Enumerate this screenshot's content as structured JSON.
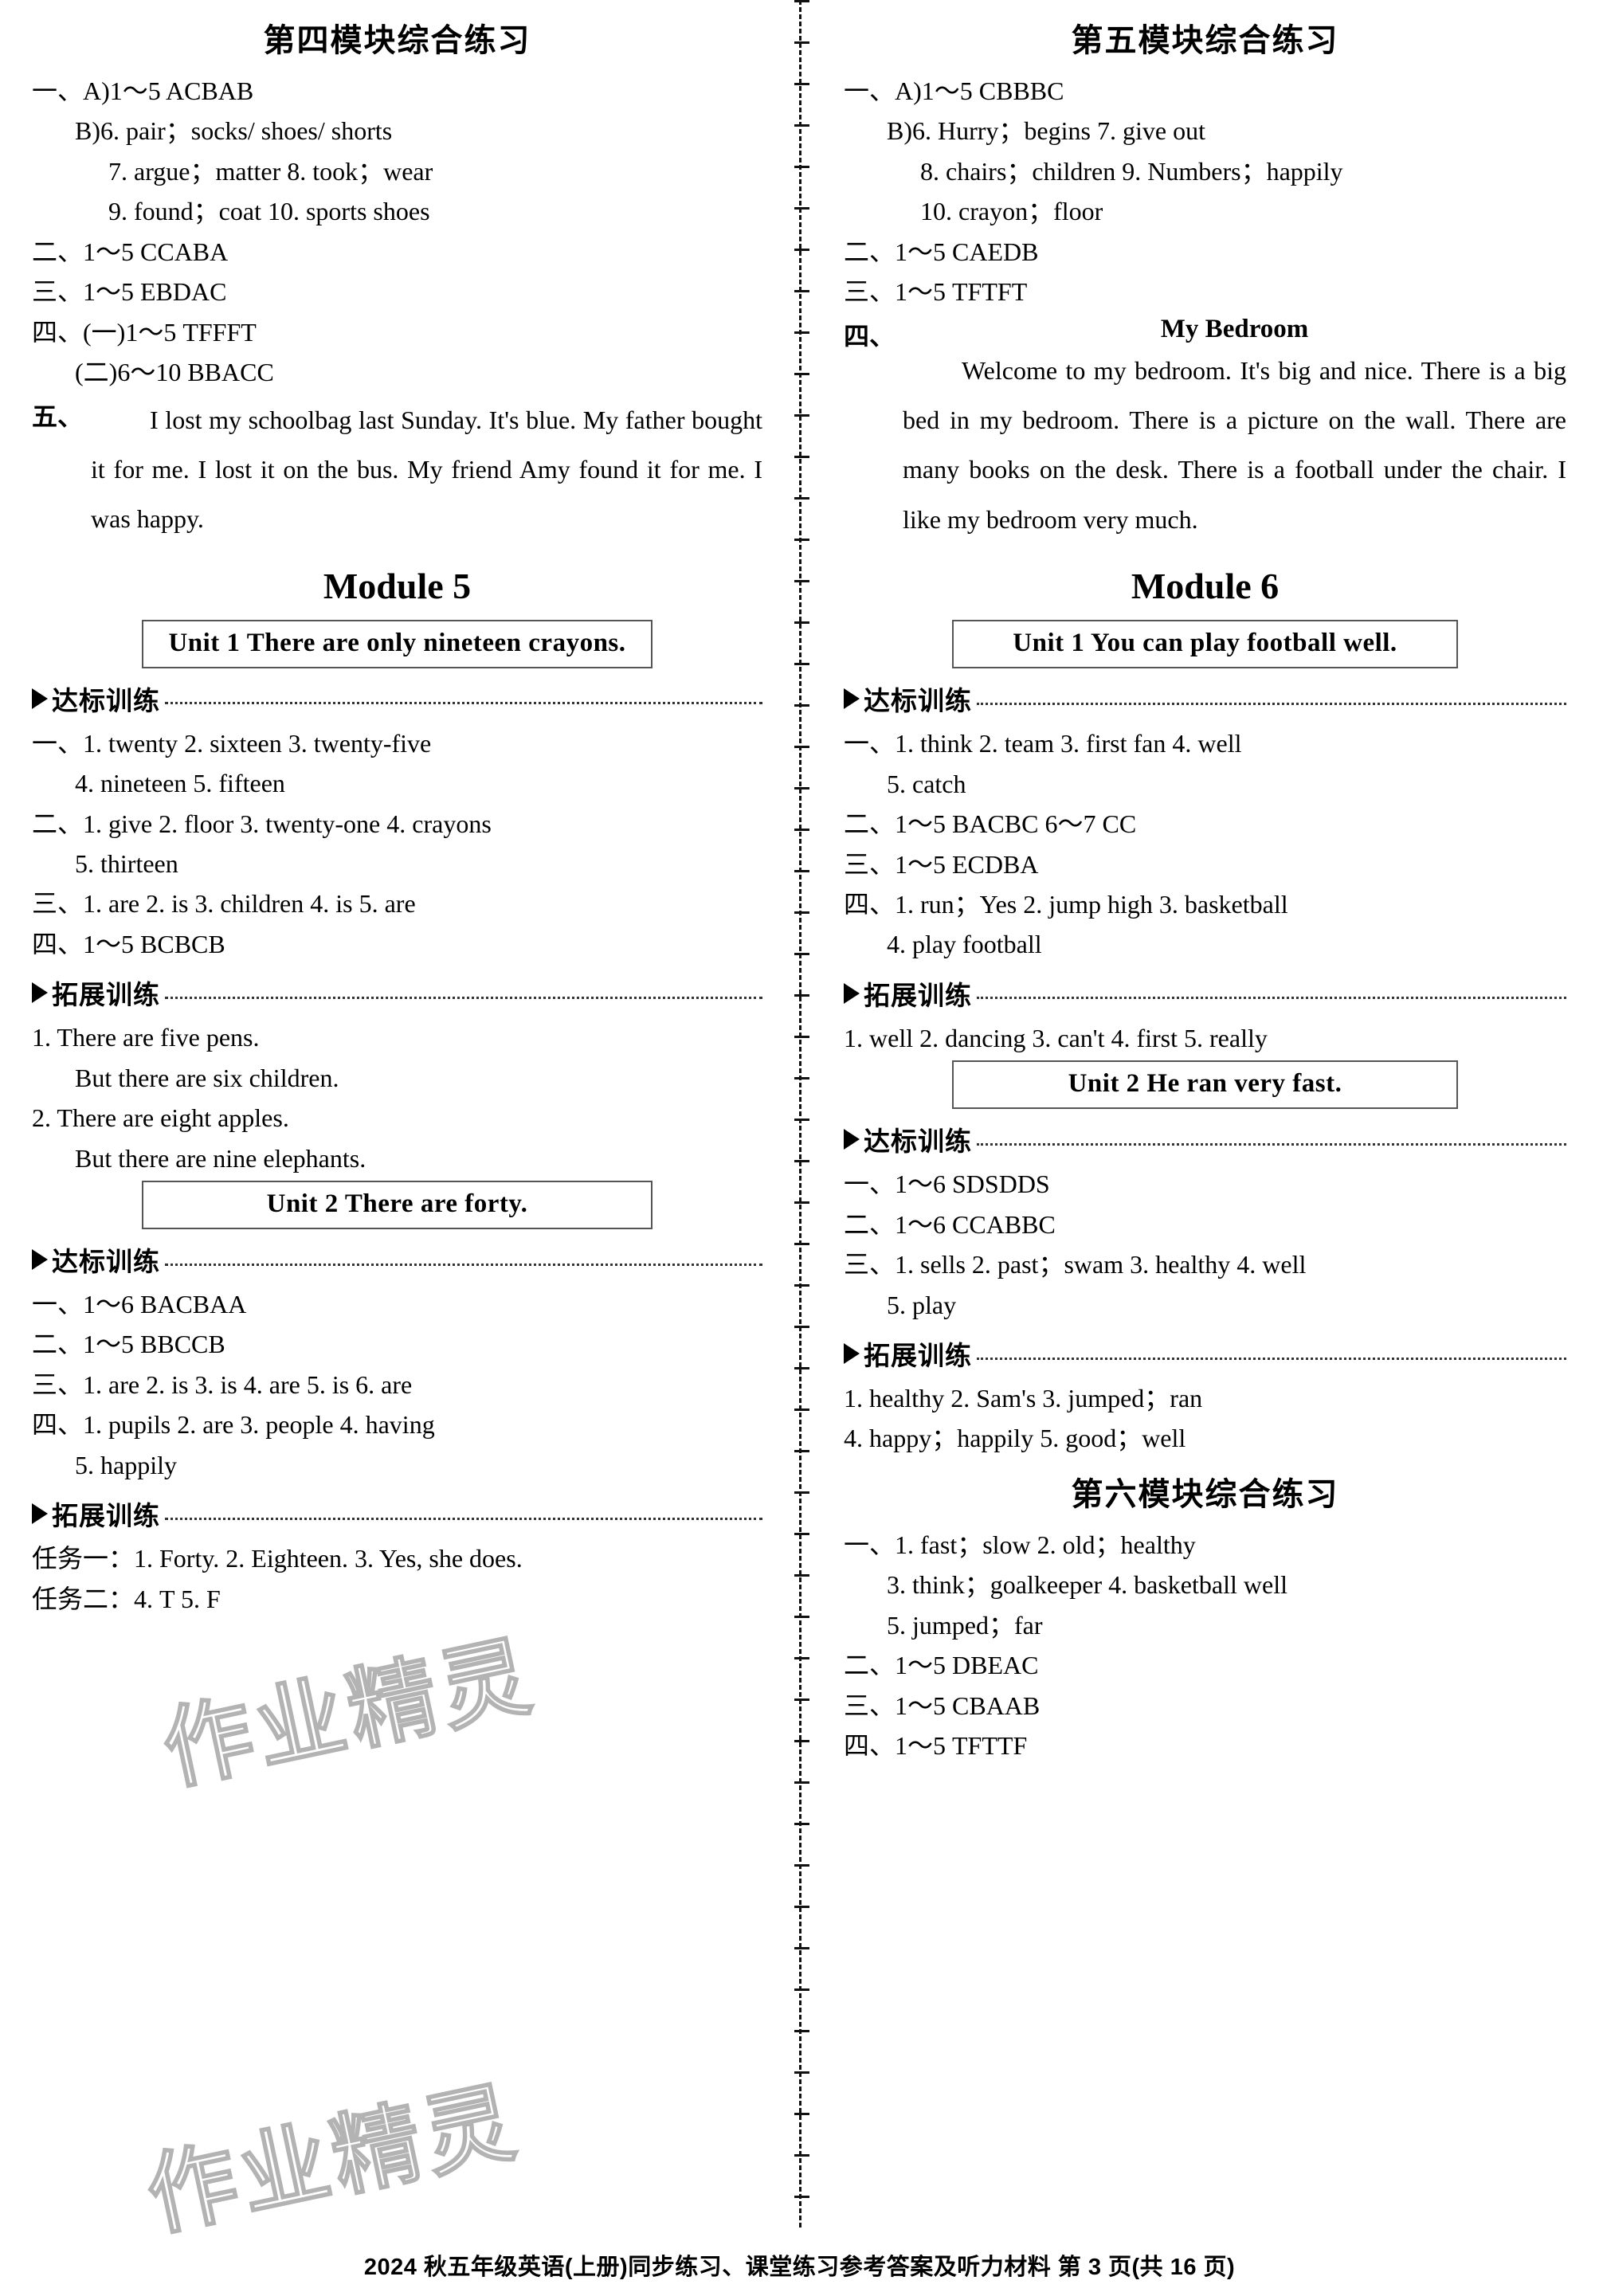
{
  "footer": {
    "text": "2024 秋五年级英语(上册)同步练习、课堂练习参考答案及听力材料  第 3 页(共 16 页)"
  },
  "watermark": {
    "text": "作业精灵"
  },
  "labels": {
    "dabiao": "达标训练",
    "tuozhan": "拓展训练"
  },
  "left_column": {
    "title": "第四模块综合练习",
    "lines": [
      {
        "indent": 0,
        "text": "一、A)1～5  ACBAB"
      },
      {
        "indent": 1,
        "text": "B)6. pair；socks/ shoes/ shorts"
      },
      {
        "indent": 2,
        "text": "7. argue；matter   8. took；wear"
      },
      {
        "indent": 2,
        "text": "9. found；coat   10. sports shoes"
      },
      {
        "indent": 0,
        "text": "二、1～5 CCABA"
      },
      {
        "indent": 0,
        "text": "三、1～5 EBDAC"
      },
      {
        "indent": 0,
        "text": "四、(一)1～5  TFFFT"
      },
      {
        "indent": 1,
        "text": "(二)6～10  BBACC"
      }
    ],
    "essay": {
      "marker": "五、",
      "body": "I lost my schoolbag last Sunday. It's blue. My father bought it for me. I lost it on the bus. My friend Amy found it for me. I was happy."
    },
    "module_title": "Module 5",
    "unit1": {
      "box": "Unit 1    There are only nineteen crayons.",
      "dabiao_lines": [
        {
          "indent": 0,
          "text": "一、1. twenty   2. sixteen   3. twenty-five"
        },
        {
          "indent": 1,
          "text": "4. nineteen   5. fifteen"
        },
        {
          "indent": 0,
          "text": "二、1. give   2. floor   3. twenty-one   4. crayons"
        },
        {
          "indent": 1,
          "text": "5. thirteen"
        },
        {
          "indent": 0,
          "text": "三、1. are   2. is   3. children   4. is   5. are"
        },
        {
          "indent": 0,
          "text": "四、1～5 BCBCB"
        }
      ],
      "tuozhan_lines": [
        {
          "indent": 0,
          "text": "1. There are five pens."
        },
        {
          "indent": 1,
          "text": "But there are six children."
        },
        {
          "indent": 0,
          "text": "2. There are eight apples."
        },
        {
          "indent": 1,
          "text": "But there are nine elephants."
        }
      ]
    },
    "unit2": {
      "box": "Unit 2    There are forty.",
      "dabiao_lines": [
        {
          "indent": 0,
          "text": "一、1～6 BACBAA"
        },
        {
          "indent": 0,
          "text": "二、1～5 BBCCB"
        },
        {
          "indent": 0,
          "text": "三、1. are   2. is   3. is   4. are   5. is   6. are"
        },
        {
          "indent": 0,
          "text": "四、1. pupils   2. are   3. people   4. having"
        },
        {
          "indent": 1,
          "text": "5. happily"
        }
      ],
      "tuozhan_lines": [
        {
          "indent": 0,
          "text": "任务一：1. Forty.   2. Eighteen.   3. Yes, she does."
        },
        {
          "indent": 0,
          "text": "任务二：4. T   5. F"
        }
      ]
    }
  },
  "right_column": {
    "title": "第五模块综合练习",
    "lines": [
      {
        "indent": 0,
        "text": "一、A)1～5  CBBBC"
      },
      {
        "indent": 1,
        "text": "B)6. Hurry；begins   7. give out"
      },
      {
        "indent": 2,
        "text": "8. chairs；children   9. Numbers；happily"
      },
      {
        "indent": 2,
        "text": "10. crayon；floor"
      },
      {
        "indent": 0,
        "text": "二、1～5 CAEDB"
      },
      {
        "indent": 0,
        "text": "三、1～5 TFTFT"
      }
    ],
    "essay": {
      "marker": "四、",
      "title": "My Bedroom",
      "body": "Welcome to my bedroom. It's big and nice. There is a big bed in my bedroom. There is a picture on the wall. There are many books on the desk. There is a football under the chair. I like my bedroom very much."
    },
    "module_title": "Module 6",
    "unit1": {
      "box": "Unit 1    You can play football well.",
      "dabiao_lines": [
        {
          "indent": 0,
          "text": "一、1. think   2. team   3. first fan   4. well"
        },
        {
          "indent": 1,
          "text": "5. catch"
        },
        {
          "indent": 0,
          "text": "二、1～5 BACBC   6～7 CC"
        },
        {
          "indent": 0,
          "text": "三、1～5 ECDBA"
        },
        {
          "indent": 0,
          "text": "四、1. run；Yes   2. jump high   3. basketball"
        },
        {
          "indent": 1,
          "text": "4. play football"
        }
      ],
      "tuozhan_lines": [
        {
          "indent": 0,
          "text": "1. well   2. dancing   3. can't   4. first   5. really"
        }
      ]
    },
    "unit2": {
      "box": "Unit 2    He ran very fast.",
      "dabiao_lines": [
        {
          "indent": 0,
          "text": "一、1～6 SDSDDS"
        },
        {
          "indent": 0,
          "text": "二、1～6 CCABBC"
        },
        {
          "indent": 0,
          "text": "三、1. sells   2. past；swam   3. healthy   4. well"
        },
        {
          "indent": 1,
          "text": "5. play"
        }
      ],
      "tuozhan_lines": [
        {
          "indent": 0,
          "text": "1. healthy   2. Sam's   3. jumped；ran"
        },
        {
          "indent": 0,
          "text": "4. happy；happily   5. good；well"
        }
      ]
    },
    "module6_title": "第六模块综合练习",
    "module6_lines": [
      {
        "indent": 0,
        "text": "一、1. fast；slow   2. old；healthy"
      },
      {
        "indent": 1,
        "text": "3. think；goalkeeper   4. basketball well"
      },
      {
        "indent": 1,
        "text": "5. jumped；far"
      },
      {
        "indent": 0,
        "text": "二、1～5 DBEAC"
      },
      {
        "indent": 0,
        "text": "三、1～5 CBAAB"
      },
      {
        "indent": 0,
        "text": "四、1～5 TFTTF"
      }
    ]
  }
}
